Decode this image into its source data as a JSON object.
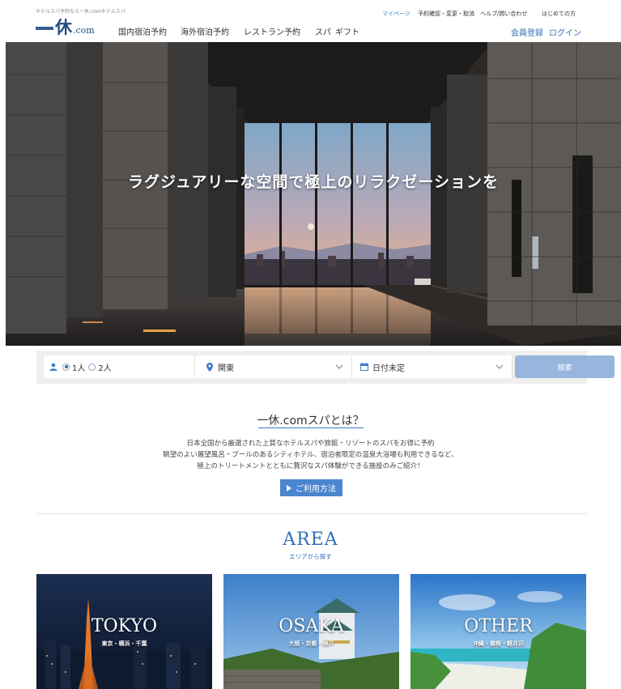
{
  "header": {
    "tagline": "ホテルスパ予約なら一休.comホテルスパ",
    "logo_kanji": "休",
    "logo_com": ".com",
    "nav": [
      "国内宿泊予約",
      "海外宿泊予約",
      "レストラン予約",
      "スパ",
      "ギフト"
    ],
    "util": {
      "mypage": "マイページ",
      "reserve": "予約確認・変更・取消",
      "help": "ヘルプ/問い合わせ",
      "first": "はじめての方"
    },
    "register": "会員登録",
    "login": "ログイン"
  },
  "hero": {
    "title": "ラグジュアリーな空間で極上のリラクゼーションを"
  },
  "search": {
    "people_options": [
      "1人",
      "2人"
    ],
    "people_selected": "1人",
    "area_value": "関東",
    "date_value": "日付未定",
    "button": "検索"
  },
  "about": {
    "title": "一休.comスパとは？",
    "lines": [
      "日本全国から厳選された上質なホテルスパや旅館・リゾートのスパをお得に予約",
      "眺望のよい展望風呂・プールのあるシティホテル、宿泊者限定の温泉大浴場も利用できるなど、",
      "極上のトリートメントとともに贅沢なスパ体験ができる施設のみご紹介！"
    ],
    "howto_button": "ご利用方法"
  },
  "area": {
    "title": "AREA",
    "subtitle": "エリアから探す",
    "cards": [
      {
        "name": "TOKYO",
        "cities": "東京・横浜・千葉"
      },
      {
        "name": "OSAKA",
        "cities": "大阪・京都・神戸"
      },
      {
        "name": "OTHER",
        "cities": "沖縄・箱根・軽井沢"
      }
    ]
  },
  "colors": {
    "brand": "#1f4f80",
    "link": "#2f6fb7",
    "search_button": "#97b6dd",
    "howto_button": "#4a85cf"
  }
}
